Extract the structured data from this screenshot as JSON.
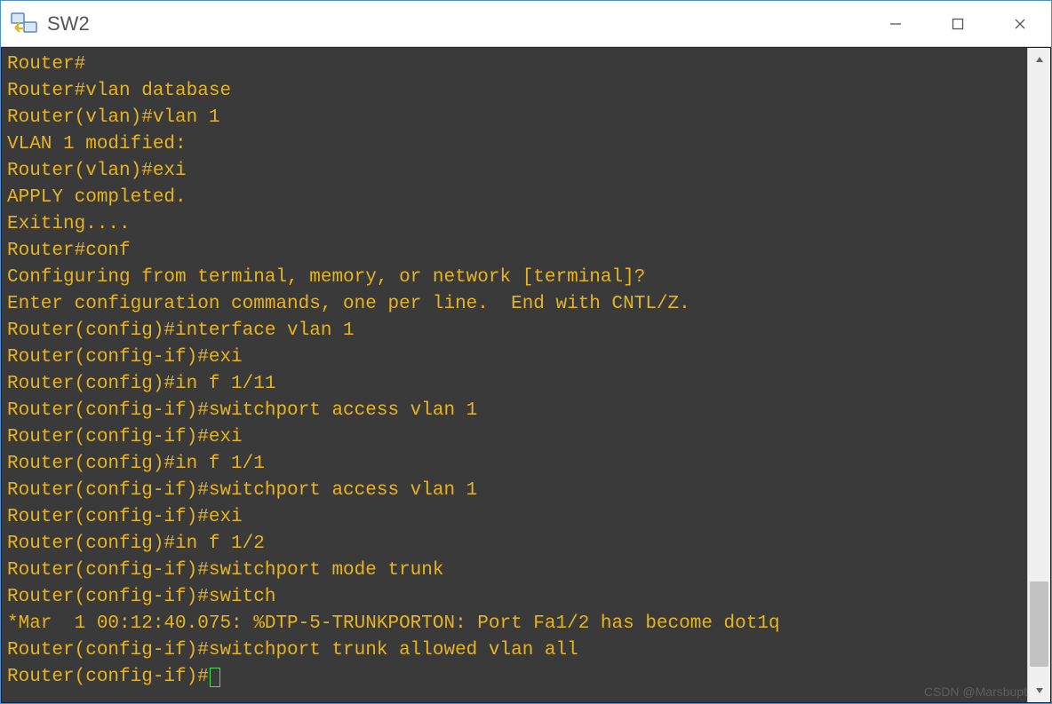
{
  "window": {
    "title": "SW2"
  },
  "terminal": {
    "lines": [
      "Router#",
      "Router#vlan database",
      "Router(vlan)#vlan 1",
      "VLAN 1 modified:",
      "Router(vlan)#exi",
      "APPLY completed.",
      "Exiting....",
      "Router#conf",
      "Configuring from terminal, memory, or network [terminal]?",
      "Enter configuration commands, one per line.  End with CNTL/Z.",
      "Router(config)#interface vlan 1",
      "Router(config-if)#exi",
      "Router(config)#in f 1/11",
      "Router(config-if)#switchport access vlan 1",
      "Router(config-if)#exi",
      "Router(config)#in f 1/1",
      "Router(config-if)#switchport access vlan 1",
      "Router(config-if)#exi",
      "Router(config)#in f 1/2",
      "Router(config-if)#switchport mode trunk",
      "Router(config-if)#switch",
      "*Mar  1 00:12:40.075: %DTP-5-TRUNKPORTON: Port Fa1/2 has become dot1q",
      "Router(config-if)#switchport trunk allowed vlan all",
      "Router(config-if)#"
    ],
    "cursor_on_last_line": true
  },
  "watermark": "CSDN @Marsbupt"
}
